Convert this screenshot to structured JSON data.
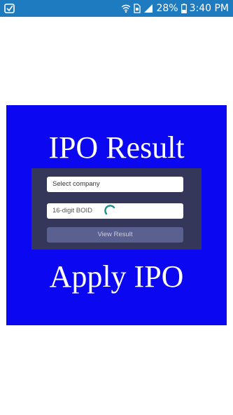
{
  "status_bar": {
    "battery_percent": "28%",
    "time": "3:40 PM"
  },
  "promo": {
    "title": "IPO Result",
    "footer": "Apply IPO",
    "background_color": "#0b07f0"
  },
  "form": {
    "company_select_label": "Select company",
    "boid_placeholder": "16-digit BOID",
    "view_result_label": "View Result"
  }
}
